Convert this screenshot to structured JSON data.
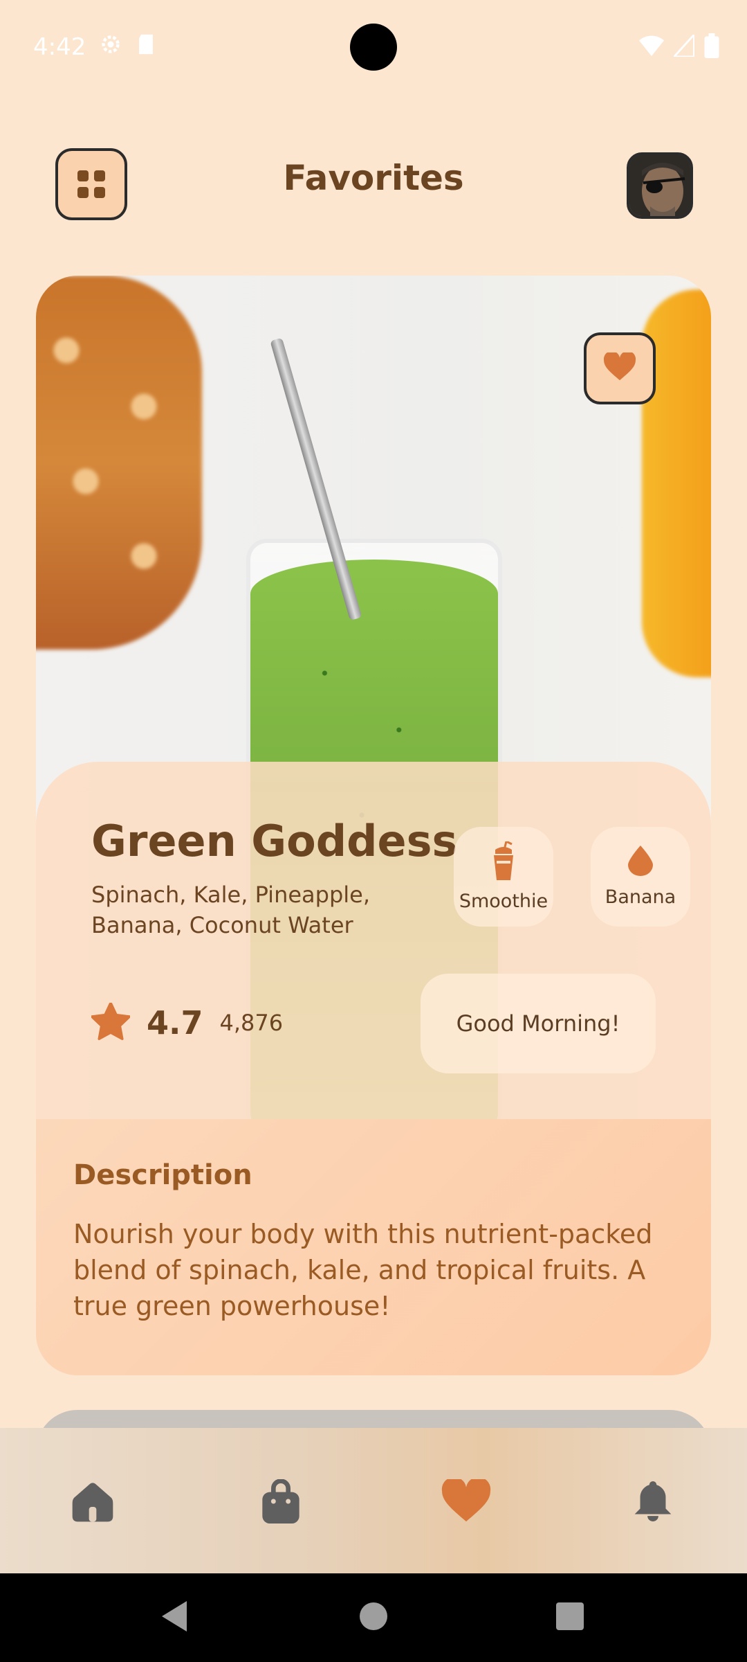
{
  "status_bar": {
    "time": "4:42",
    "icons": [
      "settings-icon",
      "sd-card-icon",
      "wifi-icon",
      "signal-icon",
      "battery-icon"
    ]
  },
  "header": {
    "title": "Favorites",
    "menu_icon": "grid-icon",
    "avatar_icon": "avatar"
  },
  "card": {
    "drink_name": "Green Goddess",
    "ingredients": "Spinach, Kale, Pineapple, Banana, Coconut Water",
    "favorite_icon": "heart-icon",
    "chips": [
      {
        "label": "Smoothie",
        "icon": "cup-icon"
      },
      {
        "label": "Banana",
        "icon": "drop-icon"
      }
    ],
    "rating": "4.7",
    "rating_count": "4,876",
    "greeting_button": "Good Morning!",
    "description_title": "Description",
    "description_text": "Nourish your body with this nutrient-packed blend of spinach, kale, and tropical fruits. A true green powerhouse!"
  },
  "bottom_nav": {
    "items": [
      {
        "icon": "home-icon",
        "active": false
      },
      {
        "icon": "bag-icon",
        "active": false
      },
      {
        "icon": "heart-icon",
        "active": true
      },
      {
        "icon": "bell-icon",
        "active": false
      }
    ]
  },
  "colors": {
    "background": "#FDE6D0",
    "accent": "#D9773A",
    "text_dark": "#6B4422",
    "text_brown": "#9A5A23",
    "inactive_icon": "#5F5F5F"
  }
}
